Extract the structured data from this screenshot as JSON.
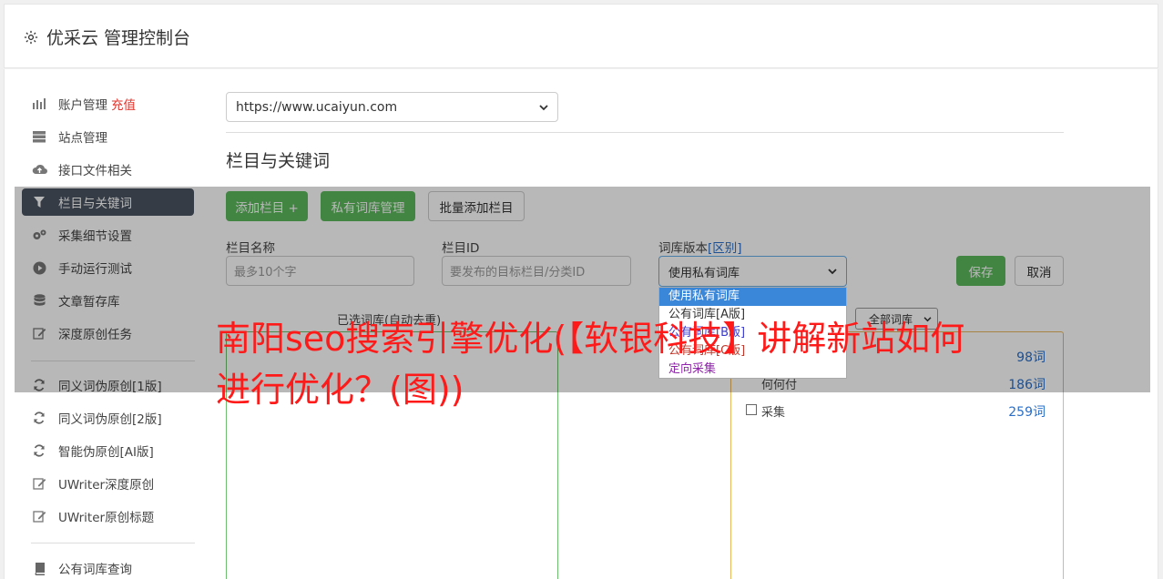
{
  "header": {
    "title": "优采云 管理控制台",
    "icon": "gear-icon"
  },
  "sidebar": {
    "items": [
      {
        "label": "账户管理",
        "badge": "充值",
        "icon": "bar-chart-icon"
      },
      {
        "label": "站点管理",
        "icon": "server-icon"
      },
      {
        "label": "接口文件相关",
        "icon": "cloud-upload-icon"
      },
      {
        "label": "栏目与关键词",
        "icon": "filter-icon",
        "active": true
      },
      {
        "label": "采集细节设置",
        "icon": "gears-icon"
      },
      {
        "label": "手动运行测试",
        "icon": "play-circle-icon"
      },
      {
        "label": "文章暂存库",
        "icon": "database-icon"
      },
      {
        "label": "深度原创任务",
        "icon": "edit-icon"
      },
      {
        "label": "同义词伪原创[1版]",
        "icon": "refresh-icon"
      },
      {
        "label": "同义词伪原创[2版]",
        "icon": "refresh-icon"
      },
      {
        "label": "智能伪原创[AI版]",
        "icon": "refresh-icon"
      },
      {
        "label": "UWriter深度原创",
        "icon": "edit-icon"
      },
      {
        "label": "UWriter原创标题",
        "icon": "edit-icon"
      },
      {
        "label": "公有词库查询",
        "icon": "book-icon"
      }
    ]
  },
  "site_select": {
    "value": "https://www.ucaiyun.com"
  },
  "section": {
    "title": "栏目与关键词"
  },
  "toolbar": {
    "add_column": "添加栏目 +",
    "private_lib": "私有词库管理",
    "batch_add": "批量添加栏目"
  },
  "form": {
    "name_label": "栏目名称",
    "name_placeholder": "最多10个字",
    "id_label": "栏目ID",
    "id_placeholder": "要发布的目标栏目/分类ID",
    "lib_label": "词库版本",
    "lib_label_link": "[区别]",
    "lib_value": "使用私有词库",
    "save": "保存",
    "cancel": "取消"
  },
  "dropdown": {
    "options": [
      {
        "label": "使用私有词库",
        "color": "#ffffff"
      },
      {
        "label": "公有词库[A版]",
        "color": "#333333"
      },
      {
        "label": "公有词库[B版]",
        "color": "#3a3ad0"
      },
      {
        "label": "公有词库[C版]",
        "color": "#c0392b"
      },
      {
        "label": "定向采集",
        "color": "#8e24aa"
      }
    ]
  },
  "boxes": {
    "left_header": "已选词库(自动去重)",
    "filter_value": "全部词库",
    "right_partial_label": "何何付",
    "right_item_label": "采集",
    "counts": [
      "98词",
      "186词",
      "259词"
    ]
  },
  "headline": "南阳seo搜索引擎优化(【软银科技】讲解新站如何进行优化？(图))"
}
